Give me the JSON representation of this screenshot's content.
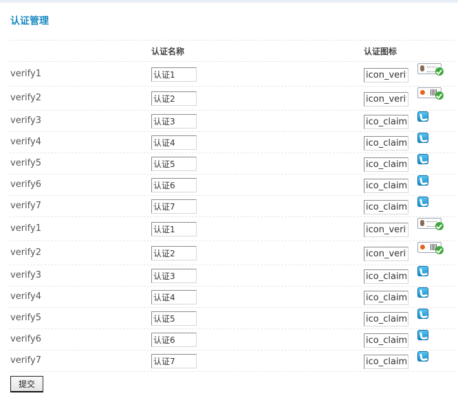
{
  "page_title": "认证管理",
  "headers": {
    "name": "认证名称",
    "icon": "认证图标"
  },
  "rows": [
    {
      "key": "verify1",
      "name": "认证1",
      "icon": "icon_verify",
      "icon_type": "id-card-icon"
    },
    {
      "key": "verify2",
      "name": "认证2",
      "icon": "icon_verify",
      "icon_type": "business-license-icon"
    },
    {
      "key": "verify3",
      "name": "认证3",
      "icon": "ico_claimed",
      "icon_type": "phone-icon"
    },
    {
      "key": "verify4",
      "name": "认证4",
      "icon": "ico_claimed",
      "icon_type": "phone-icon"
    },
    {
      "key": "verify5",
      "name": "认证5",
      "icon": "ico_claimed",
      "icon_type": "phone-icon"
    },
    {
      "key": "verify6",
      "name": "认证6",
      "icon": "ico_claimed",
      "icon_type": "phone-icon"
    },
    {
      "key": "verify7",
      "name": "认证7",
      "icon": "ico_claimed",
      "icon_type": "phone-icon"
    },
    {
      "key": "verify1",
      "name": "认证1",
      "icon": "icon_verify",
      "icon_type": "id-card-icon"
    },
    {
      "key": "verify2",
      "name": "认证2",
      "icon": "icon_verify",
      "icon_type": "business-license-icon"
    },
    {
      "key": "verify3",
      "name": "认证3",
      "icon": "ico_claimed",
      "icon_type": "phone-icon"
    },
    {
      "key": "verify4",
      "name": "认证4",
      "icon": "ico_claimed",
      "icon_type": "phone-icon"
    },
    {
      "key": "verify5",
      "name": "认证5",
      "icon": "ico_claimed",
      "icon_type": "phone-icon"
    },
    {
      "key": "verify6",
      "name": "认证6",
      "icon": "ico_claimed",
      "icon_type": "phone-icon"
    },
    {
      "key": "verify7",
      "name": "认证7",
      "icon": "ico_claimed",
      "icon_type": "phone-icon"
    }
  ],
  "submit_label": "提交",
  "colors": {
    "title": "#1a8bc0",
    "text": "#555555",
    "divider": "#e6e6e6"
  }
}
